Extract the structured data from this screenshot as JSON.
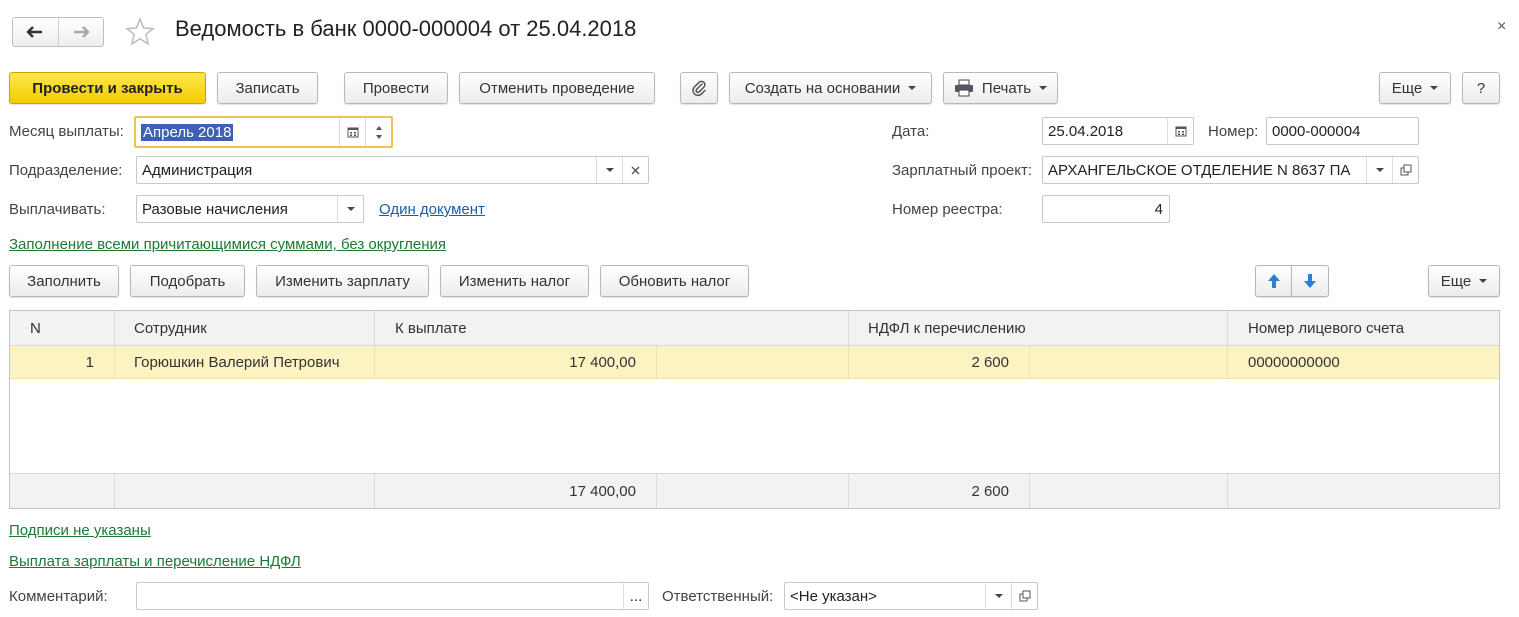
{
  "window": {
    "title": "Ведомость в банк 0000-000004 от 25.04.2018",
    "close_symbol": "×"
  },
  "toolbar": {
    "post_close": "Провести и закрыть",
    "save": "Записать",
    "post": "Провести",
    "unpost": "Отменить проведение",
    "create_based": "Создать на основании",
    "print": "Печать",
    "more": "Еще",
    "help": "?"
  },
  "form": {
    "month_label": "Месяц выплаты:",
    "month_value": "Апрель 2018",
    "department_label": "Подразделение:",
    "department_value": "Администрация",
    "pay_label": "Выплачивать:",
    "pay_value": "Разовые начисления",
    "one_document_link": "Один документ",
    "date_label": "Дата:",
    "date_value": "25.04.2018",
    "number_label": "Номер:",
    "number_value": "0000-000004",
    "project_label": "Зарплатный проект:",
    "project_value": "АРХАНГЕЛЬСКОЕ ОТДЕЛЕНИЕ N 8637 ПА",
    "registry_label": "Номер реестра:",
    "registry_value": "4",
    "fill_mode_link": "Заполнение всеми причитающимися суммами, без округления"
  },
  "table_toolbar": {
    "fill": "Заполнить",
    "select": "Подобрать",
    "change_salary": "Изменить зарплату",
    "change_tax": "Изменить налог",
    "update_tax": "Обновить налог",
    "more": "Еще"
  },
  "table": {
    "columns": [
      "N",
      "Сотрудник",
      "К выплате",
      "НДФЛ к перечислению",
      "Номер лицевого счета"
    ],
    "rows": [
      {
        "n": "1",
        "employee": "Горюшкин Валерий Петрович",
        "payout": "17 400,00",
        "ndfl": "2 600",
        "account": "00000000000"
      }
    ],
    "totals": {
      "payout": "17 400,00",
      "ndfl": "2 600"
    }
  },
  "footer": {
    "signatures_link": "Подписи не указаны",
    "payment_link": "Выплата зарплаты и перечисление НДФЛ",
    "comment_label": "Комментарий:",
    "comment_value": "",
    "comment_button": "...",
    "responsible_label": "Ответственный:",
    "responsible_value": "<Не указан>"
  },
  "colors": {
    "primary_button": "#f3cc00",
    "row_highlight": "#fbf4c2",
    "link_green": "#1c7a34",
    "link_blue": "#1d5ea8",
    "selection": "#3d5fb5"
  }
}
